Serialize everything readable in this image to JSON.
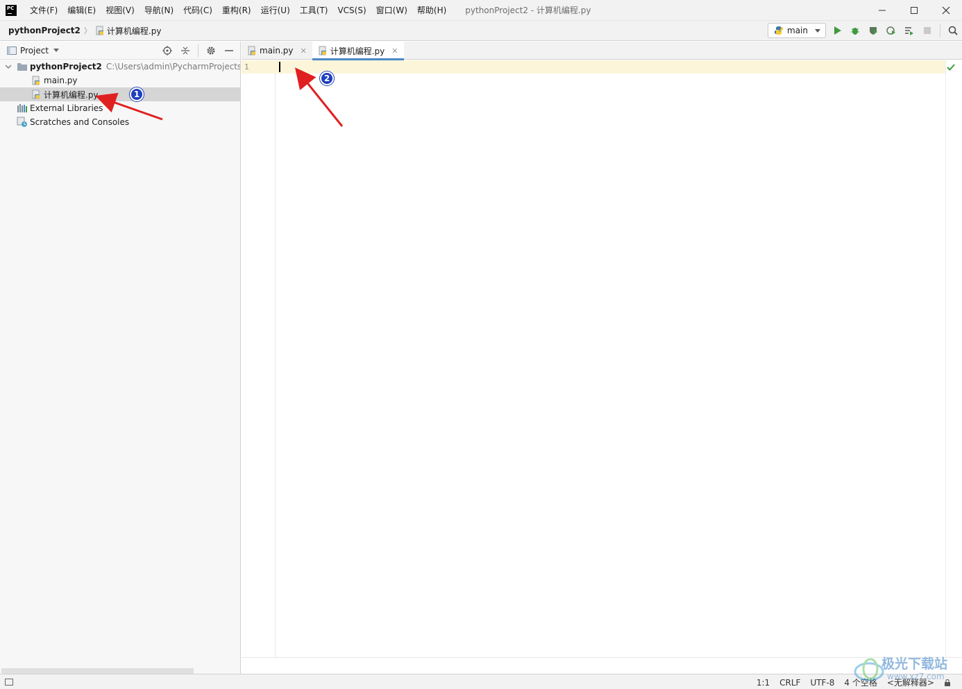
{
  "menu": {
    "items": [
      "文件(F)",
      "编辑(E)",
      "视图(V)",
      "导航(N)",
      "代码(C)",
      "重构(R)",
      "运行(U)",
      "工具(T)",
      "VCS(S)",
      "窗口(W)",
      "帮助(H)"
    ],
    "window_title": "pythonProject2 - 计算机编程.py"
  },
  "navbar": {
    "project": "pythonProject2",
    "file": "计算机编程.py",
    "run_config": "main"
  },
  "project_panel": {
    "title": "Project",
    "root_name": "pythonProject2",
    "root_path": "C:\\Users\\admin\\PycharmProjects\\p",
    "files": [
      "main.py",
      "计算机编程.py"
    ],
    "external_libraries": "External Libraries",
    "scratches": "Scratches and Consoles"
  },
  "tabs": [
    {
      "label": "main.py",
      "active": false
    },
    {
      "label": "计算机编程.py",
      "active": true
    }
  ],
  "editor": {
    "line_number": "1"
  },
  "status": {
    "position": "1:1",
    "line_sep": "CRLF",
    "encoding": "UTF-8",
    "indent": "4 个空格",
    "interpreter": "<无解释器>"
  },
  "annotations": {
    "badge_1": "1",
    "badge_2": "2",
    "arrow_color": "#e02020"
  },
  "watermark": {
    "text": "极光下载站",
    "sub": "www.xz7.com"
  },
  "colors": {
    "accent": "#4a88c7",
    "current_line": "#fcf5d9",
    "run_green": "#3f9a3f"
  }
}
